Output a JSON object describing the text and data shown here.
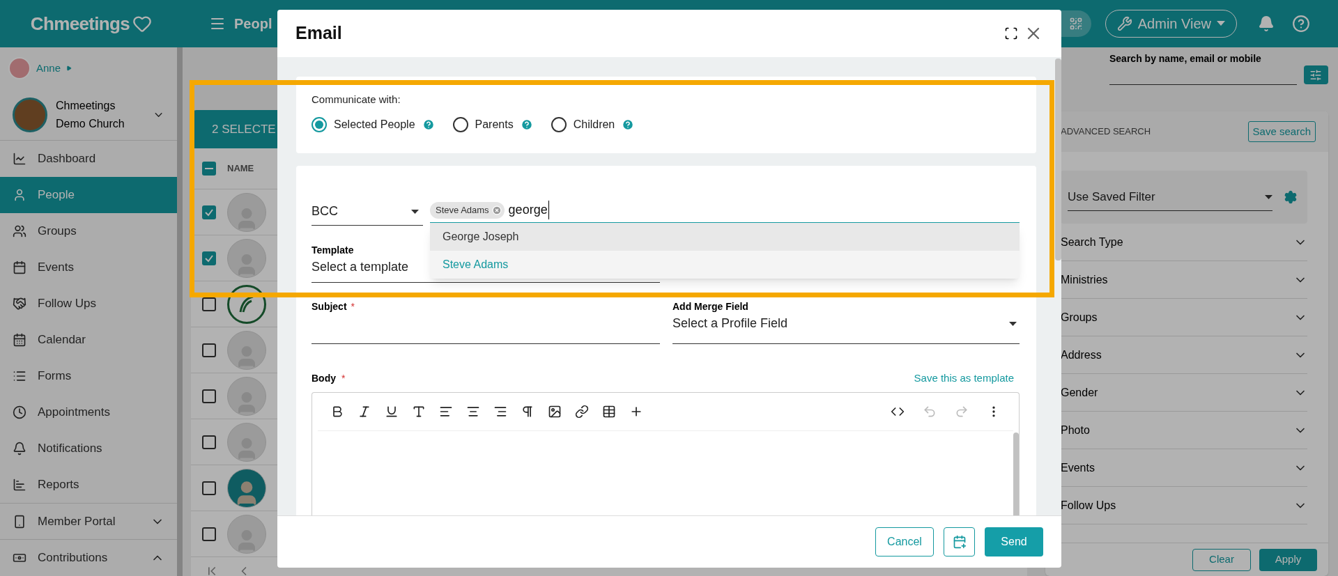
{
  "header": {
    "logo": "Chmeetings",
    "page_title": "Peopl",
    "admin_view": "Admin View"
  },
  "sidebar": {
    "user": "Anne",
    "church": "Chmeetings Demo Church",
    "items": [
      {
        "label": "Dashboard",
        "selected": false,
        "kind": "link"
      },
      {
        "label": "People",
        "selected": true,
        "kind": "link"
      },
      {
        "label": "Groups",
        "selected": false,
        "kind": "link"
      },
      {
        "label": "Events",
        "selected": false,
        "kind": "link"
      },
      {
        "label": "Follow Ups",
        "selected": false,
        "kind": "link"
      },
      {
        "label": "Calendar",
        "selected": false,
        "kind": "link"
      },
      {
        "label": "Forms",
        "selected": false,
        "kind": "link"
      },
      {
        "label": "Appointments",
        "selected": false,
        "kind": "link"
      },
      {
        "label": "Notifications",
        "selected": false,
        "kind": "link"
      },
      {
        "label": "Reports",
        "selected": false,
        "kind": "link"
      },
      {
        "label": "Member Portal",
        "selected": false,
        "kind": "group",
        "expanded": false
      },
      {
        "label": "Contributions",
        "selected": false,
        "kind": "group",
        "expanded": true
      }
    ]
  },
  "table": {
    "banner": "2 SELECTE",
    "column": "NAME",
    "header_indeterminate": true,
    "rows": [
      {
        "checked": true,
        "kind": "placeholder"
      },
      {
        "checked": true,
        "kind": "placeholder"
      },
      {
        "checked": false,
        "kind": "logo"
      },
      {
        "checked": false,
        "kind": "placeholder"
      },
      {
        "checked": false,
        "kind": "placeholder"
      },
      {
        "checked": false,
        "kind": "placeholder"
      },
      {
        "checked": false,
        "kind": "person"
      },
      {
        "checked": false,
        "kind": "placeholder"
      }
    ]
  },
  "search_panel": {
    "search_label": "Search by name, email or mobile",
    "advanced": "ADVANCED SEARCH",
    "save_search": "Save search",
    "saved_filter": "Use Saved Filter",
    "filters": [
      "Search Type",
      "Ministries",
      "Groups",
      "Address",
      "Gender",
      "Photo",
      "Events",
      "Follow Ups"
    ],
    "clear": "Clear",
    "apply": "Apply"
  },
  "modal": {
    "title": "Email",
    "communicate_label": "Communicate with:",
    "options": [
      {
        "label": "Selected People",
        "selected": true
      },
      {
        "label": "Parents",
        "selected": false
      },
      {
        "label": "Children",
        "selected": false
      }
    ],
    "recipient_type": "BCC",
    "chips": [
      "Steve Adams"
    ],
    "typed": "george",
    "suggestions": [
      {
        "label": "George Joseph",
        "hovered": true,
        "selected": false
      },
      {
        "label": "Steve Adams",
        "hovered": false,
        "selected": true
      }
    ],
    "template_label": "Template",
    "template_value": "Select a template",
    "subject_label": "Subject",
    "subject_mark": "*",
    "merge_label": "Add Merge Field",
    "merge_value": "Select a Profile Field",
    "body_label": "Body",
    "body_mark": "*",
    "save_template": "Save this as template",
    "cancel": "Cancel",
    "send": "Send"
  }
}
